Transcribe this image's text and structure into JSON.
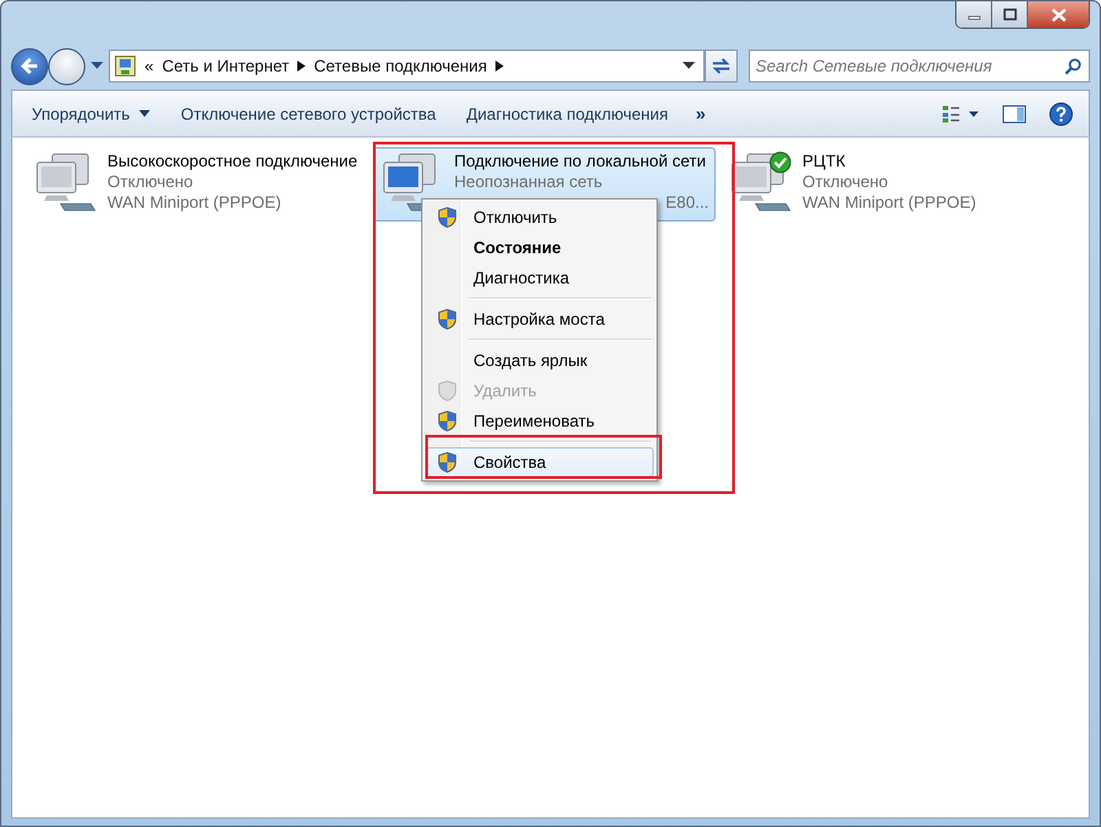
{
  "address_bar": {
    "overflow": "«",
    "segments": [
      "Сеть и Интернет",
      "Сетевые подключения"
    ]
  },
  "search": {
    "placeholder": "Search Сетевые подключения"
  },
  "toolbar": {
    "buttons": [
      {
        "label": "Упорядочить",
        "dropdown": true
      },
      {
        "label": "Отключение сетевого устройства",
        "dropdown": false
      },
      {
        "label": "Диагностика подключения",
        "dropdown": false
      }
    ],
    "more": "»"
  },
  "connections": [
    {
      "name": "Высокоскоростное подключение",
      "status": "Отключено",
      "device": "WAN Miniport (PPPOE)",
      "selected": false,
      "connected": false
    },
    {
      "name": "Подключение по локальной сети",
      "status": "Неопознанная сеть",
      "device": "E80...",
      "selected": true,
      "connected": false
    },
    {
      "name": "РЦТК",
      "status": "Отключено",
      "device": "WAN Miniport (PPPOE)",
      "selected": false,
      "connected": true
    }
  ],
  "context_menu": {
    "items": [
      {
        "kind": "item",
        "label": "Отключить",
        "shield": true,
        "bold": false,
        "disabled": false,
        "selected": false
      },
      {
        "kind": "item",
        "label": "Состояние",
        "shield": false,
        "bold": true,
        "disabled": false,
        "selected": false
      },
      {
        "kind": "item",
        "label": "Диагностика",
        "shield": false,
        "bold": false,
        "disabled": false,
        "selected": false
      },
      {
        "kind": "separator"
      },
      {
        "kind": "item",
        "label": "Настройка моста",
        "shield": true,
        "bold": false,
        "disabled": false,
        "selected": false
      },
      {
        "kind": "separator"
      },
      {
        "kind": "item",
        "label": "Создать ярлык",
        "shield": false,
        "bold": false,
        "disabled": false,
        "selected": false
      },
      {
        "kind": "item",
        "label": "Удалить",
        "shield": true,
        "bold": false,
        "disabled": true,
        "selected": false
      },
      {
        "kind": "item",
        "label": "Переименовать",
        "shield": true,
        "bold": false,
        "disabled": false,
        "selected": false
      },
      {
        "kind": "separator"
      },
      {
        "kind": "item",
        "label": "Свойства",
        "shield": true,
        "bold": false,
        "disabled": false,
        "selected": true
      }
    ]
  }
}
